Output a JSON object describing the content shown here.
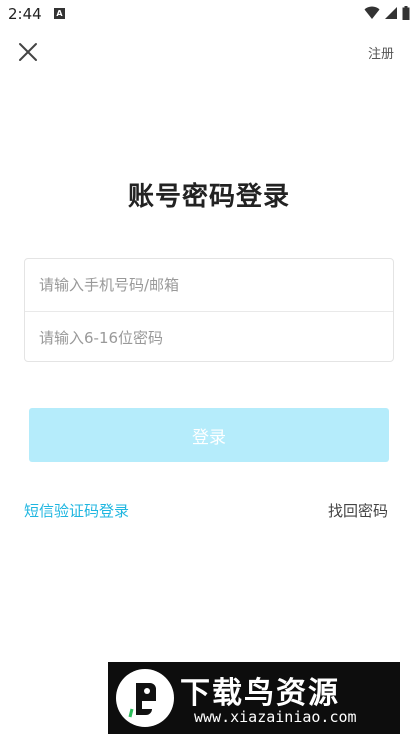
{
  "status_bar": {
    "time": "2:44",
    "notification_icon": "A",
    "icons": [
      "wifi-icon",
      "signal-icon",
      "battery-icon"
    ]
  },
  "header": {
    "close_icon": "close-icon",
    "register_label": "注册"
  },
  "title": "账号密码登录",
  "form": {
    "phone_placeholder": "请输入手机号码/邮箱",
    "phone_value": "",
    "password_placeholder": "请输入6-16位密码",
    "password_value": ""
  },
  "login_button": "登录",
  "links": {
    "sms_login": "短信验证码登录",
    "forgot_password": "找回密码"
  },
  "watermark": {
    "title": "下载鸟资源",
    "url": "www.xiazainiao.com"
  },
  "colors": {
    "accent": "#1fb6e0",
    "login_button_bg": "#b5ecfb",
    "background": "#ffffff"
  }
}
